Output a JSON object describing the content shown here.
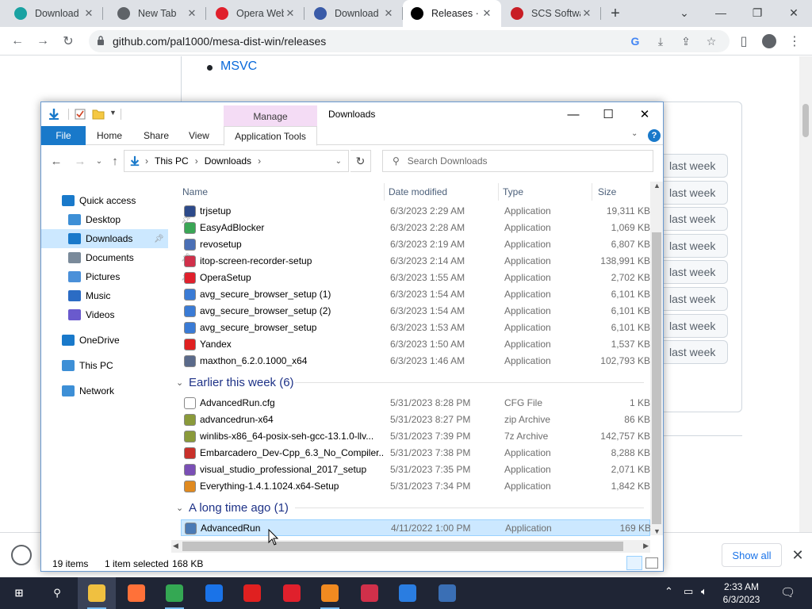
{
  "browser": {
    "tabs": [
      {
        "label": "Download",
        "icon": "feather-icon",
        "color": "#1aa2a2"
      },
      {
        "label": "New Tab",
        "icon": "chrome-icon",
        "color": "#5f6368"
      },
      {
        "label": "Opera Web",
        "icon": "opera-icon",
        "color": "#e0202c"
      },
      {
        "label": "Download",
        "icon": "download-page-icon",
        "color": "#3a5ba8"
      },
      {
        "label": "Releases · p",
        "icon": "github-icon",
        "color": "#000000"
      },
      {
        "label": "SCS Softwa",
        "icon": "scs-icon",
        "color": "#c81d25"
      }
    ],
    "new_tab_label": "+",
    "url": "github.com/pal1000/mesa-dist-win/releases"
  },
  "webpage": {
    "bullets": [
      "MSVC"
    ],
    "last_week_label": "last week",
    "last_week_count": 8
  },
  "download_bar": {
    "show_all": "Show all",
    "close": "✕"
  },
  "explorer": {
    "contextual_tab_group": "Manage",
    "title": "Downloads",
    "ribbon_tabs": [
      "File",
      "Home",
      "Share",
      "View"
    ],
    "active_contextual_tab": "Application Tools",
    "breadcrumb": [
      "This PC",
      "Downloads"
    ],
    "search_placeholder": "Search Downloads",
    "nav_pane": [
      {
        "label": "Quick access",
        "icon": "star-icon",
        "color": "#1979ca"
      },
      {
        "label": "Desktop",
        "icon": "desktop-icon",
        "color": "#3d8fd6",
        "pinned": true
      },
      {
        "label": "Downloads",
        "icon": "downloads-icon",
        "color": "#1979ca",
        "pinned": true,
        "selected": true
      },
      {
        "label": "Documents",
        "icon": "documents-icon",
        "color": "#7a8a9a",
        "pinned": true
      },
      {
        "label": "Pictures",
        "icon": "pictures-icon",
        "color": "#4a90d9",
        "pinned": true
      },
      {
        "label": "Music",
        "icon": "music-icon",
        "color": "#2b6cc4"
      },
      {
        "label": "Videos",
        "icon": "videos-icon",
        "color": "#6a5acd"
      },
      {
        "label": "OneDrive",
        "icon": "onedrive-icon",
        "color": "#1979ca"
      },
      {
        "label": "This PC",
        "icon": "pc-icon",
        "color": "#3d8fd6"
      },
      {
        "label": "Network",
        "icon": "network-icon",
        "color": "#3d8fd6"
      }
    ],
    "columns": [
      "Name",
      "Date modified",
      "Type",
      "Size"
    ],
    "rows_today": [
      {
        "name": "trjsetup",
        "date": "6/3/2023 2:29 AM",
        "type": "Application",
        "size": "19,311 KB",
        "color": "#2d4a8a"
      },
      {
        "name": "EasyAdBlocker",
        "date": "6/3/2023 2:28 AM",
        "type": "Application",
        "size": "1,069 KB",
        "color": "#3aa655"
      },
      {
        "name": "revosetup",
        "date": "6/3/2023 2:19 AM",
        "type": "Application",
        "size": "6,807 KB",
        "color": "#4a6fb5"
      },
      {
        "name": "itop-screen-recorder-setup",
        "date": "6/3/2023 2:14 AM",
        "type": "Application",
        "size": "138,991 KB",
        "color": "#d0304a"
      },
      {
        "name": "OperaSetup",
        "date": "6/3/2023 1:55 AM",
        "type": "Application",
        "size": "2,702 KB",
        "color": "#e0202c"
      },
      {
        "name": "avg_secure_browser_setup (1)",
        "date": "6/3/2023 1:54 AM",
        "type": "Application",
        "size": "6,101 KB",
        "color": "#3a7bd5"
      },
      {
        "name": "avg_secure_browser_setup (2)",
        "date": "6/3/2023 1:54 AM",
        "type": "Application",
        "size": "6,101 KB",
        "color": "#3a7bd5"
      },
      {
        "name": "avg_secure_browser_setup",
        "date": "6/3/2023 1:53 AM",
        "type": "Application",
        "size": "6,101 KB",
        "color": "#3a7bd5"
      },
      {
        "name": "Yandex",
        "date": "6/3/2023 1:50 AM",
        "type": "Application",
        "size": "1,537 KB",
        "color": "#e02020"
      },
      {
        "name": "maxthon_6.2.0.1000_x64",
        "date": "6/3/2023 1:46 AM",
        "type": "Application",
        "size": "102,793 KB",
        "color": "#5a6a8a"
      }
    ],
    "group_week": "Earlier this week (6)",
    "rows_week": [
      {
        "name": "AdvancedRun.cfg",
        "date": "5/31/2023 8:28 PM",
        "type": "CFG File",
        "size": "1 KB",
        "color": "#ffffff"
      },
      {
        "name": "advancedrun-x64",
        "date": "5/31/2023 8:27 PM",
        "type": "zip Archive",
        "size": "86 KB",
        "color": "#8a9a3a"
      },
      {
        "name": "winlibs-x86_64-posix-seh-gcc-13.1.0-llv...",
        "date": "5/31/2023 7:39 PM",
        "type": "7z Archive",
        "size": "142,757 KB",
        "color": "#8a9a3a"
      },
      {
        "name": "Embarcadero_Dev-Cpp_6.3_No_Compiler...",
        "date": "5/31/2023 7:38 PM",
        "type": "Application",
        "size": "8,288 KB",
        "color": "#c8302a"
      },
      {
        "name": "visual_studio_professional_2017_setup",
        "date": "5/31/2023 7:35 PM",
        "type": "Application",
        "size": "2,071 KB",
        "color": "#7a4fb5"
      },
      {
        "name": "Everything-1.4.1.1024.x64-Setup",
        "date": "5/31/2023 7:34 PM",
        "type": "Application",
        "size": "1,842 KB",
        "color": "#e08a20"
      }
    ],
    "group_old": "A long time ago (1)",
    "rows_old": [
      {
        "name": "AdvancedRun",
        "date": "4/11/2022 1:00 PM",
        "type": "Application",
        "size": "169 KB",
        "color": "#4a7ab5"
      }
    ],
    "status_items": "19 items",
    "status_selected": "1 item selected",
    "status_size": "168 KB"
  },
  "taskbar": {
    "apps": [
      {
        "name": "start-button",
        "color": "#ffffff"
      },
      {
        "name": "search-icon",
        "color": "#ffffff"
      },
      {
        "name": "file-explorer-icon",
        "color": "#f0c040",
        "active": true
      },
      {
        "name": "firefox-icon",
        "color": "#ff7139"
      },
      {
        "name": "chrome-icon",
        "color": "#34a853",
        "running": true
      },
      {
        "name": "app-m-icon",
        "color": "#1a73e8"
      },
      {
        "name": "yandex-icon",
        "color": "#e02020"
      },
      {
        "name": "opera-icon",
        "color": "#e0202c"
      },
      {
        "name": "avg-browser-icon",
        "color": "#f08a20",
        "running": true
      },
      {
        "name": "screen-recorder-icon",
        "color": "#d0304a"
      },
      {
        "name": "video-app-icon",
        "color": "#2a7de1"
      },
      {
        "name": "revo-icon",
        "color": "#3a6fb5"
      }
    ],
    "time": "2:33 AM",
    "date": "6/3/2023"
  }
}
